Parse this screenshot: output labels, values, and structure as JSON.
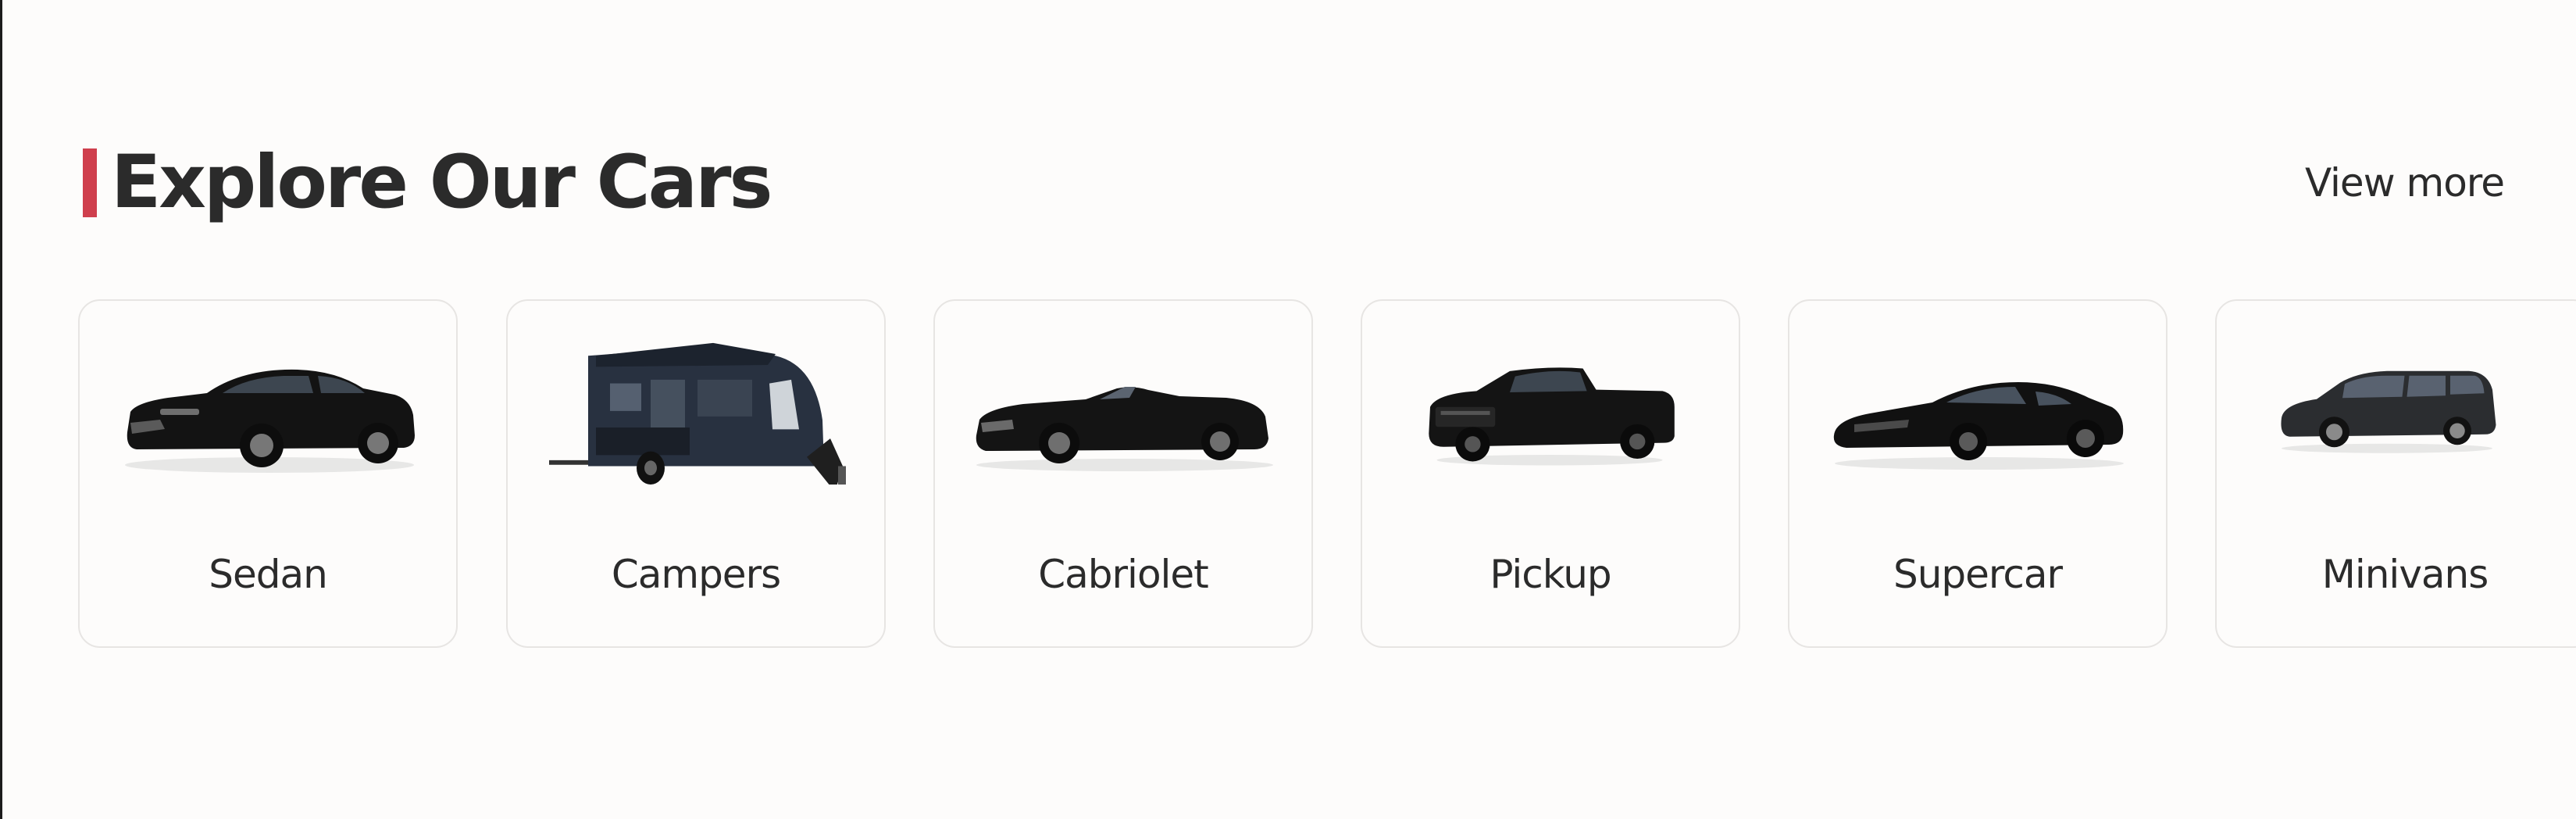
{
  "section": {
    "title": "Explore Our Cars",
    "view_more_label": "View more",
    "accent_color": "#cf3f4d"
  },
  "categories": [
    {
      "label": "Sedan",
      "icon": "sedan-car-icon"
    },
    {
      "label": "Campers",
      "icon": "camper-trailer-icon"
    },
    {
      "label": "Cabriolet",
      "icon": "cabriolet-car-icon"
    },
    {
      "label": "Pickup",
      "icon": "pickup-truck-icon"
    },
    {
      "label": "Supercar",
      "icon": "supercar-icon"
    },
    {
      "label": "Minivans",
      "icon": "minivan-icon"
    }
  ]
}
